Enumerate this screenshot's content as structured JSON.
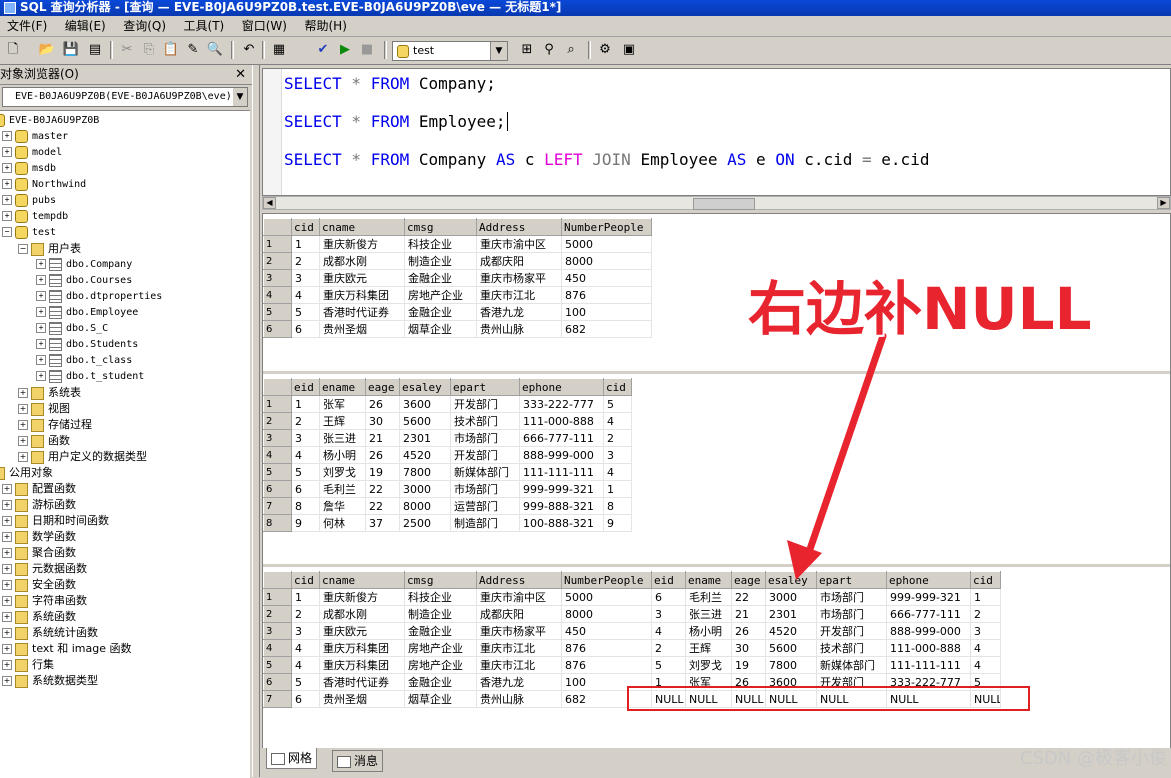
{
  "window": {
    "title": "SQL 查询分析器 - [查询 — EVE-B0JA6U9PZ0B.test.EVE-B0JA6U9PZ0B\\eve — 无标题1*]"
  },
  "menu": [
    "文件(F)",
    "编辑(E)",
    "查询(Q)",
    "工具(T)",
    "窗口(W)",
    "帮助(H)"
  ],
  "toolbar": {
    "database": "test"
  },
  "object_browser": {
    "title": "对象浏览器(O)",
    "close": "✕",
    "server_select": "EVE-B0JA6U9PZ0B(EVE-B0JA6U9PZ0B\\eve)",
    "server": "EVE-B0JA6U9PZ0B",
    "databases": [
      "master",
      "model",
      "msdb",
      "Northwind",
      "pubs",
      "tempdb",
      "test"
    ],
    "user_tables_label": "用户表",
    "tables": [
      "dbo.Company",
      "dbo.Courses",
      "dbo.dtproperties",
      "dbo.Employee",
      "dbo.S_C",
      "dbo.Students",
      "dbo.t_class",
      "dbo.t_student"
    ],
    "test_children": [
      "系统表",
      "视图",
      "存储过程",
      "函数",
      "用户定义的数据类型"
    ],
    "common_label": "公用对象",
    "common_children": [
      "配置函数",
      "游标函数",
      "日期和时间函数",
      "数学函数",
      "聚合函数",
      "元数据函数",
      "安全函数",
      "字符串函数",
      "系统函数",
      "系统统计函数",
      "text 和 image 函数",
      "行集",
      "系统数据类型"
    ]
  },
  "editor": {
    "line1": {
      "k1": "SELECT",
      "op1": " * ",
      "k2": "FROM",
      "t": " Company;"
    },
    "line2": {
      "k1": "SELECT",
      "op1": " * ",
      "k2": "FROM",
      "t": " Employee;"
    },
    "line3": {
      "k1": "SELECT",
      "op1": " * ",
      "k2": "FROM",
      "t1": " Company ",
      "k3": "AS",
      "t2": " c ",
      "f1": "LEFT",
      "f2": " JOIN",
      "t3": " Employee ",
      "k4": "AS",
      "t4": " e ",
      "k5": "ON",
      "t5": " c.cid ",
      "op2": "=",
      "t6": " e.cid"
    }
  },
  "results": {
    "grid1": {
      "columns": [
        "cid",
        "cname",
        "cmsg",
        "Address",
        "NumberPeople"
      ],
      "rows": [
        [
          "1",
          "1",
          "重庆新俊方",
          "科技企业",
          "重庆市渝中区",
          "5000"
        ],
        [
          "2",
          "2",
          "成都水刚",
          "制造企业",
          "成都庆阳",
          "8000"
        ],
        [
          "3",
          "3",
          "重庆欧元",
          "金融企业",
          "重庆市杨家平",
          "450"
        ],
        [
          "4",
          "4",
          "重庆万科集团",
          "房地产企业",
          "重庆市江北",
          "876"
        ],
        [
          "5",
          "5",
          "香港时代证券",
          "金融企业",
          "香港九龙",
          "100"
        ],
        [
          "6",
          "6",
          "贵州圣烟",
          "烟草企业",
          "贵州山脉",
          "682"
        ]
      ]
    },
    "grid2": {
      "columns": [
        "eid",
        "ename",
        "eage",
        "esaley",
        "epart",
        "ephone",
        "cid"
      ],
      "rows": [
        [
          "1",
          "1",
          "张军",
          "26",
          "3600",
          "开发部门",
          "333-222-777",
          "5"
        ],
        [
          "2",
          "2",
          "王辉",
          "30",
          "5600",
          "技术部门",
          "111-000-888",
          "4"
        ],
        [
          "3",
          "3",
          "张三进",
          "21",
          "2301",
          "市场部门",
          "666-777-111",
          "2"
        ],
        [
          "4",
          "4",
          "杨小明",
          "26",
          "4520",
          "开发部门",
          "888-999-000",
          "3"
        ],
        [
          "5",
          "5",
          "刘罗戈",
          "19",
          "7800",
          "新媒体部门",
          "111-111-111",
          "4"
        ],
        [
          "6",
          "6",
          "毛利兰",
          "22",
          "3000",
          "市场部门",
          "999-999-321",
          "1"
        ],
        [
          "7",
          "8",
          "詹华",
          "22",
          "8000",
          "运营部门",
          "999-888-321",
          "8"
        ],
        [
          "8",
          "9",
          "何林",
          "37",
          "2500",
          "制造部门",
          "100-888-321",
          "9"
        ]
      ]
    },
    "grid3": {
      "columns": [
        "cid",
        "cname",
        "cmsg",
        "Address",
        "NumberPeople",
        "eid",
        "ename",
        "eage",
        "esaley",
        "epart",
        "ephone",
        "cid"
      ],
      "rows": [
        [
          "1",
          "1",
          "重庆新俊方",
          "科技企业",
          "重庆市渝中区",
          "5000",
          "6",
          "毛利兰",
          "22",
          "3000",
          "市场部门",
          "999-999-321",
          "1"
        ],
        [
          "2",
          "2",
          "成都水刚",
          "制造企业",
          "成都庆阳",
          "8000",
          "3",
          "张三进",
          "21",
          "2301",
          "市场部门",
          "666-777-111",
          "2"
        ],
        [
          "3",
          "3",
          "重庆欧元",
          "金融企业",
          "重庆市杨家平",
          "450",
          "4",
          "杨小明",
          "26",
          "4520",
          "开发部门",
          "888-999-000",
          "3"
        ],
        [
          "4",
          "4",
          "重庆万科集团",
          "房地产企业",
          "重庆市江北",
          "876",
          "2",
          "王辉",
          "30",
          "5600",
          "技术部门",
          "111-000-888",
          "4"
        ],
        [
          "5",
          "4",
          "重庆万科集团",
          "房地产企业",
          "重庆市江北",
          "876",
          "5",
          "刘罗戈",
          "19",
          "7800",
          "新媒体部门",
          "111-111-111",
          "4"
        ],
        [
          "6",
          "5",
          "香港时代证券",
          "金融企业",
          "香港九龙",
          "100",
          "1",
          "张军",
          "26",
          "3600",
          "开发部门",
          "333-222-777",
          "5"
        ],
        [
          "7",
          "6",
          "贵州圣烟",
          "烟草企业",
          "贵州山脉",
          "682",
          "NULL",
          "NULL",
          "NULL",
          "NULL",
          "NULL",
          "NULL",
          "NULL"
        ]
      ]
    }
  },
  "tabs": [
    "网格",
    "消息"
  ],
  "annotation": "右边补NULL",
  "annotation_color": "#e8242f",
  "watermark": "CSDN @极客小俊"
}
